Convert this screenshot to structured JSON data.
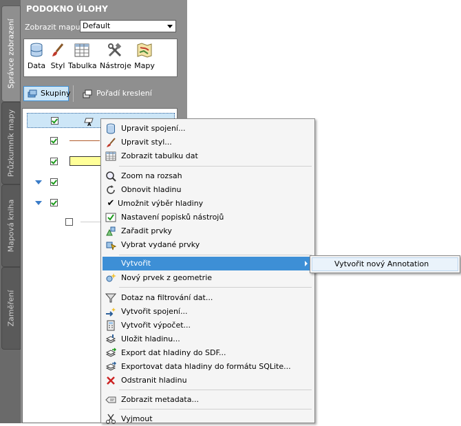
{
  "panel": {
    "title": "PODOKNO ÚLOHY",
    "side_tabs": [
      "Správce zobrazení",
      "Průzkumník mapy",
      "Mapová kniha",
      "Zaměření"
    ],
    "map_label": "Zobrazit mapu:",
    "map_value": "Default",
    "tools": [
      {
        "label": "Data",
        "icon": "database-icon"
      },
      {
        "label": "Styl",
        "icon": "brush-icon"
      },
      {
        "label": "Tabulka",
        "icon": "table-icon"
      },
      {
        "label": "Nástroje",
        "icon": "tools-icon"
      },
      {
        "label": "Mapy",
        "icon": "map-icon"
      }
    ],
    "groups_button": "Skupiny",
    "draw_order_button": "Pořadí kreslení"
  },
  "context_menu": {
    "items": [
      {
        "label": "Upravit spojení...",
        "icon": "connection-icon"
      },
      {
        "label": "Upravit styl...",
        "icon": "brush-icon"
      },
      {
        "label": "Zobrazit tabulku dat",
        "icon": "table-icon"
      },
      {
        "label": "Zoom na rozsah",
        "icon": "zoom-icon"
      },
      {
        "label": "Obnovit hladinu",
        "icon": "refresh-icon"
      },
      {
        "label": "Umožnit výběr hladiny",
        "icon": "checkmark-icon"
      },
      {
        "label": "Nastavení popisků nástrojů",
        "icon": "tooltip-settings-icon"
      },
      {
        "label": "Zařadit prvky",
        "icon": "shapes-icon"
      },
      {
        "label": "Vybrat vydané prvky",
        "icon": "select-features-icon"
      },
      {
        "label": "Vytvořit",
        "icon": ""
      },
      {
        "label": "Nový prvek z geometrie",
        "icon": "new-feature-icon"
      },
      {
        "label": "Dotaz na filtrování dat...",
        "icon": "filter-icon"
      },
      {
        "label": "Vytvořit spojení...",
        "icon": "join-icon"
      },
      {
        "label": "Vytvořit výpočet...",
        "icon": "calculator-icon"
      },
      {
        "label": "Uložit hladinu...",
        "icon": "save-layer-icon"
      },
      {
        "label": "Export dat hladiny do SDF...",
        "icon": "export-icon"
      },
      {
        "label": "Exportovat data hladiny do formátu SQLite...",
        "icon": "export-sqlite-icon"
      },
      {
        "label": "Odstranit hladinu",
        "icon": "delete-icon"
      },
      {
        "label": "Zobrazit metadata...",
        "icon": "metadata-icon"
      },
      {
        "label": "Vyjmout",
        "icon": "cut-icon"
      }
    ],
    "submenu_item": "Vytvořit nový Annotation"
  },
  "colors": {
    "panel_bg": "#8f8f8f",
    "highlight": "#3d8fd6",
    "menu_bg": "#f5f5f5"
  }
}
